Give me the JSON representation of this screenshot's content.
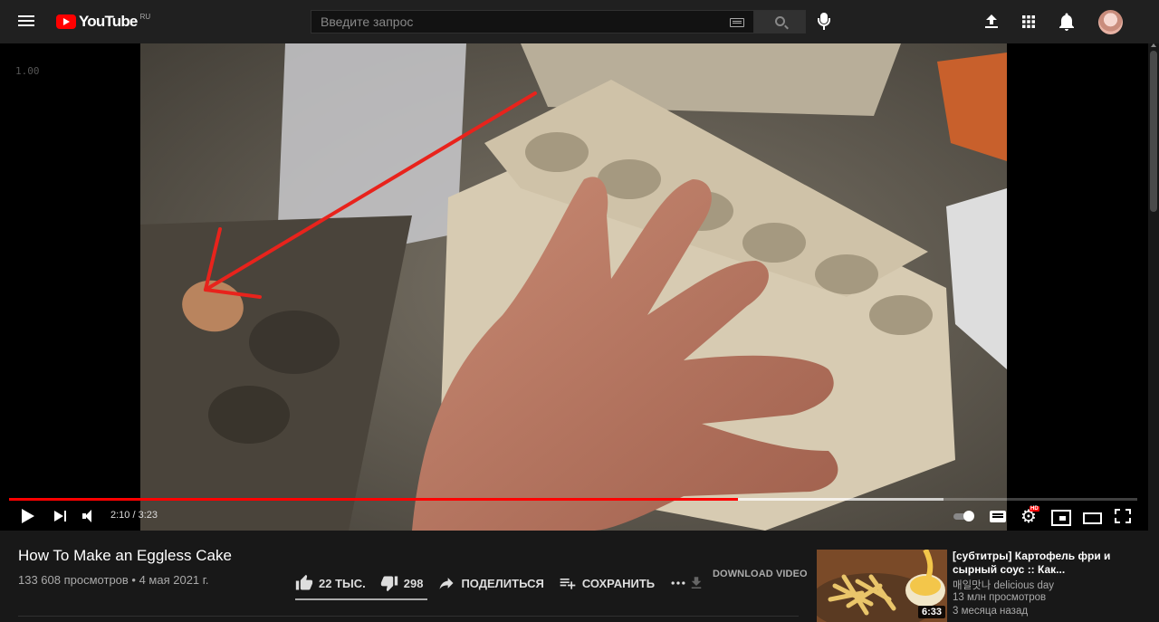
{
  "header": {
    "logo_text": "YouTube",
    "logo_region": "RU",
    "search_placeholder": "Введите запрос"
  },
  "player": {
    "speed_overlay": "1.00",
    "time_display": "2:10 / 3:23",
    "progress_fraction": 0.6457,
    "buffered_fraction": 0.828,
    "hd_badge": "HD",
    "colors": {
      "progress": "#ff0000",
      "background": "#000000"
    }
  },
  "video": {
    "title": "How To Make an Eggless Cake",
    "view_info": "133 608 просмотров • 4 мая 2021 г.",
    "actions": {
      "like_count": "22 ТЫС.",
      "dislike_count": "298",
      "share_label": "ПОДЕЛИТЬСЯ",
      "save_label": "СОХРАНИТЬ",
      "download_label": "DOWNLOAD VIDEO"
    }
  },
  "recommendation": {
    "title": "[субтитры] Картофель фри и сырный соус :: Как...",
    "channel": "매일맛나 delicious day",
    "views": "13 млн просмотров",
    "age": "3 месяца назад",
    "duration": "6:33"
  },
  "theme": {
    "page_bg": "#181818",
    "topbar_bg": "#202020",
    "accent": "#ff0000"
  }
}
